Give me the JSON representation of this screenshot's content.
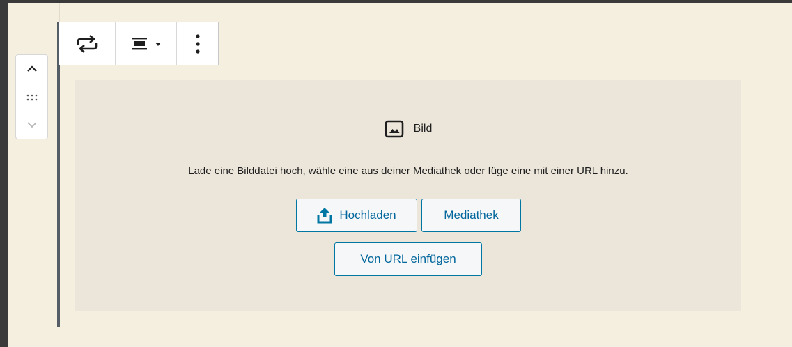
{
  "editor": {
    "block_mover": {
      "move_up_icon": "chevron-up-icon",
      "drag_icon": "drag-handle-icon",
      "move_down_icon": "chevron-down-icon"
    },
    "toolbar": {
      "transform_icon": "transform-arrows-icon",
      "align_icon": "align-center-icon",
      "more_icon": "more-vertical-icon"
    },
    "image_block": {
      "icon": "image-icon",
      "title": "Bild",
      "instructions": "Lade eine Bilddatei hoch, wähle eine aus deiner Mediathek oder füge eine mit einer URL hinzu.",
      "upload_label": "Hochladen",
      "media_library_label": "Mediathek",
      "insert_url_label": "Von URL einfügen"
    }
  },
  "colors": {
    "canvas_background": "#f5efe0",
    "placeholder_background": "#ebe5da",
    "button_text": "#00669b",
    "button_border": "#0077a3",
    "frame_background": "#3a3a3a"
  }
}
